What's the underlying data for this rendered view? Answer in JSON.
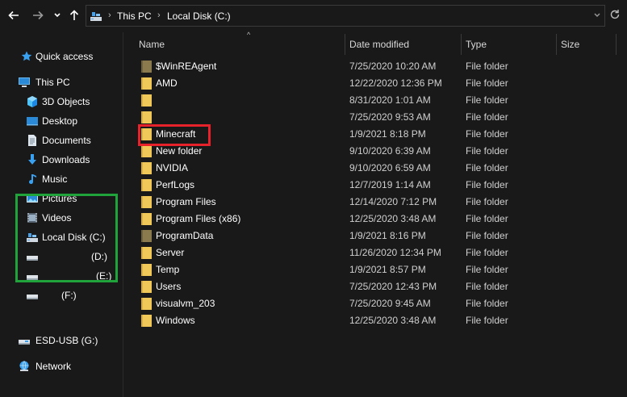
{
  "toolbar": {
    "back_icon": "arrow-left-icon",
    "forward_icon": "arrow-right-icon",
    "recent_icon": "chevron-down-icon",
    "up_icon": "arrow-up-icon"
  },
  "address": {
    "crumbs": [
      "This PC",
      "Local Disk (C:)"
    ]
  },
  "sidebar": {
    "items": [
      {
        "label": "Quick access",
        "icon": "star-icon"
      },
      {
        "label": "This PC",
        "icon": "computer-icon"
      },
      {
        "label": "3D Objects",
        "icon": "cube-icon"
      },
      {
        "label": "Desktop",
        "icon": "desktop-icon"
      },
      {
        "label": "Documents",
        "icon": "document-icon"
      },
      {
        "label": "Downloads",
        "icon": "download-icon"
      },
      {
        "label": "Music",
        "icon": "music-icon"
      },
      {
        "label": "Pictures",
        "icon": "pictures-icon"
      },
      {
        "label": "Videos",
        "icon": "video-icon"
      },
      {
        "label": "Local Disk (C:)",
        "icon": "drive-c-icon"
      },
      {
        "label": "(D:)",
        "icon": "drive-icon"
      },
      {
        "label": "(E:)",
        "icon": "drive-icon"
      },
      {
        "label": "(F:)",
        "icon": "drive-icon"
      },
      {
        "label": "ESD-USB (G:)",
        "icon": "usb-drive-icon"
      },
      {
        "label": "Network",
        "icon": "network-icon"
      }
    ]
  },
  "columns": {
    "name": "Name",
    "date": "Date modified",
    "type": "Type",
    "size": "Size"
  },
  "files": [
    {
      "name": "$WinREAgent",
      "date": "7/25/2020 10:20 AM",
      "type": "File folder"
    },
    {
      "name": "AMD",
      "date": "12/22/2020 12:36 PM",
      "type": "File folder"
    },
    {
      "name": "",
      "date": "8/31/2020 1:01 AM",
      "type": "File folder"
    },
    {
      "name": "",
      "date": "7/25/2020 9:53 AM",
      "type": "File folder"
    },
    {
      "name": "Minecraft",
      "date": "1/9/2021 8:18 PM",
      "type": "File folder"
    },
    {
      "name": "New folder",
      "date": "9/10/2020 6:39 AM",
      "type": "File folder"
    },
    {
      "name": "NVIDIA",
      "date": "9/10/2020 6:59 AM",
      "type": "File folder"
    },
    {
      "name": "PerfLogs",
      "date": "12/7/2019 1:14 AM",
      "type": "File folder"
    },
    {
      "name": "Program Files",
      "date": "12/14/2020 7:12 PM",
      "type": "File folder"
    },
    {
      "name": "Program Files (x86)",
      "date": "12/25/2020 3:48 AM",
      "type": "File folder"
    },
    {
      "name": "ProgramData",
      "date": "1/9/2021 8:16 PM",
      "type": "File folder"
    },
    {
      "name": "Server",
      "date": "11/26/2020 12:34 PM",
      "type": "File folder"
    },
    {
      "name": "Temp",
      "date": "1/9/2021 8:57 PM",
      "type": "File folder"
    },
    {
      "name": "Users",
      "date": "7/25/2020 12:43 PM",
      "type": "File folder"
    },
    {
      "name": "visualvm_203",
      "date": "7/25/2020 9:45 AM",
      "type": "File folder"
    },
    {
      "name": "Windows",
      "date": "12/25/2020 3:48 AM",
      "type": "File folder"
    }
  ],
  "colors": {
    "folder": "#f0c85a",
    "folder_dim": "#8a7a4e",
    "highlight_red": "#e8222a",
    "highlight_green": "#1fa33a"
  }
}
